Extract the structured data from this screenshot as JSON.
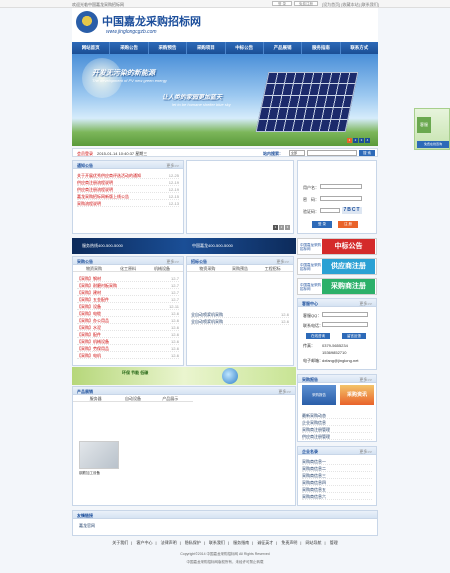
{
  "topbar": {
    "welcome": "欢迎光临中国嘉龙采购招标网",
    "btn1": "登 录",
    "btn2": "免费注册",
    "links": "[设为首页] [收藏本站] [联系我们]"
  },
  "header": {
    "title": "中国嘉龙采购招标网",
    "url": "www.jinglongcgzb.com"
  },
  "nav": [
    "网站首页",
    "采购公告",
    "采购预告",
    "采购项目",
    "中标公告",
    "产品展销",
    "服务指南",
    "联系方式"
  ],
  "banner": {
    "slogan1": "开发无污染的新能源",
    "slogan2": "The development of PV new green energy",
    "slogan3": "让人类的家园更加蓝天",
    "slogan4": "let to be humane shelter blue sky",
    "dots": [
      "1",
      "2",
      "3",
      "4"
    ]
  },
  "statusbar": {
    "login_label": "会员登录",
    "date": "2015-01-14 10:40:37 星期三",
    "search_label": "站内搜索：",
    "select": "全部",
    "button": "搜 索"
  },
  "notice": {
    "title": "通知公告",
    "more": "更多>>",
    "items": [
      {
        "t": "关于开展优秀供应商评选活动的通知",
        "d": "12-25"
      },
      {
        "t": "供应商注册流程说明",
        "d": "12-19"
      },
      {
        "t": "供应商注册流程说明",
        "d": "12-19"
      },
      {
        "t": "嘉龙采购招标网新版上线公告",
        "d": "12-15"
      },
      {
        "t": "采购流程说明",
        "d": "12-13"
      }
    ]
  },
  "slider_nums": [
    "1",
    "2",
    "3"
  ],
  "member_login": {
    "user_label": "用户名：",
    "pass_label": "密　码：",
    "code_label": "验证码：",
    "code": "7BCT",
    "login_btn": "登 录",
    "reg_btn": "注 册"
  },
  "adbar": {
    "t1": "服务热线400-500-5000",
    "t2": "中国嘉龙400-500-5000"
  },
  "side_buttons": [
    {
      "lbl": "中国嘉龙采购招标网",
      "big": "中标公告",
      "color": "#d42a2a"
    },
    {
      "lbl": "中国嘉龙采购招标网",
      "big": "供应商注册",
      "color": "#2aa1d4"
    },
    {
      "lbl": "中国嘉龙采购招标网",
      "big": "采购商注册",
      "color": "#2bb069"
    }
  ],
  "purchase_notice": {
    "title": "采购公告",
    "more": "更多>>",
    "tabs": [
      "物资采购",
      "化工原料",
      "机械设备"
    ],
    "items": [
      {
        "t": "【采购】钢材",
        "d": "12-7"
      },
      {
        "t": "【采购】耐磨衬板采购",
        "d": "12-7"
      },
      {
        "t": "【采购】建材",
        "d": "12-7"
      },
      {
        "t": "【采购】五金配件",
        "d": "12-7"
      },
      {
        "t": "【采购】设备",
        "d": "12-11"
      },
      {
        "t": "【采购】电缆",
        "d": "12-6"
      },
      {
        "t": "【采购】办公用品",
        "d": "12-6"
      },
      {
        "t": "【采购】水泥",
        "d": "12-6"
      },
      {
        "t": "【采购】配件",
        "d": "12-6"
      },
      {
        "t": "【采购】机械设备",
        "d": "12-6"
      },
      {
        "t": "【采购】劳保用品",
        "d": "12-6"
      },
      {
        "t": "【采购】电机",
        "d": "12-6"
      }
    ]
  },
  "bid_result": {
    "title": "招标公告",
    "more": "更多>>",
    "tabs": [
      "物资采购",
      "采购预告",
      "工程招标"
    ],
    "items": [
      {
        "t": "全自动喷浆机采购",
        "d": "12-6"
      },
      {
        "t": "全自动喷浆机采购",
        "d": "12-6"
      }
    ]
  },
  "greenbar": {
    "t": "环保 节能 低碳"
  },
  "products": {
    "title": "产品展销",
    "more": "更多>>",
    "tabs": [
      "服务器",
      "自动设备",
      "产品展示"
    ],
    "caption": "钢筋加工设备"
  },
  "supplier": {
    "title": "客服中心",
    "more": "更多>>",
    "fields": [
      "客服QQ：",
      "联系电话：",
      "传真：",
      "电子邮箱："
    ],
    "btn1": "在线咨询",
    "btn2": "留言反馈",
    "phone1": "0379-5655234",
    "phone2": "15369852710",
    "email": "dxfang@jinglong.net"
  },
  "procure_report": {
    "title": "采购报告",
    "more": "更多>>",
    "thumbs": [
      "采购报告",
      "采购资讯"
    ],
    "items": [
      "最新采购动态",
      "企业采购信息",
      "采购商注册管理",
      "供应商注册管理"
    ]
  },
  "enterprise_list": {
    "title": "企业名录",
    "more": "更多>>",
    "items": [
      "采购商信息一",
      "采购商信息二",
      "采购商信息三",
      "采购商信息四",
      "采购商信息五",
      "采购商信息六"
    ]
  },
  "links": {
    "title": "友情链接",
    "item": "嘉龙官网"
  },
  "footer": {
    "links": [
      "关于我们",
      "客户中心",
      "法律声明",
      "隐私保护",
      "联系我们",
      "服务指南",
      "诚征英才",
      "免责声明",
      "网站导航",
      "管理"
    ],
    "copy1": "Copyright©2014 中国嘉龙采购招标网 All Rights Reserved",
    "copy2": "中国嘉龙采购招标网版权所有，未经许可禁止转载"
  },
  "float_ad": {
    "cs": "客服",
    "cs2": "免费在线咨询"
  }
}
